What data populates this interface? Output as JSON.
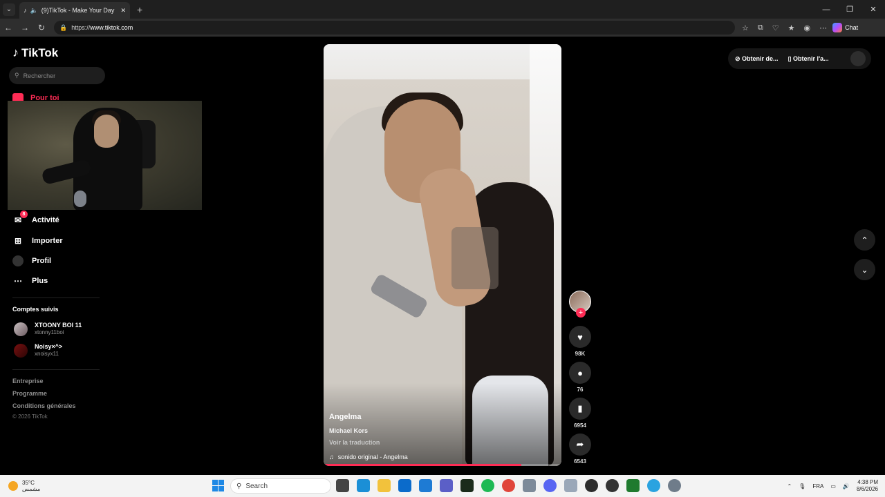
{
  "browser": {
    "tab_title": "(9)TikTok - Make Your Day",
    "url_scheme": "https://",
    "url_host": "www.tiktok.com",
    "chat_label": "Chat"
  },
  "sidebar": {
    "brand": "TikTok",
    "search_placeholder": "Rechercher",
    "for_you": "Pour toi",
    "activity": "Activité",
    "activity_badge": "8",
    "upload": "Importer",
    "profile": "Profil",
    "more": "Plus",
    "following_title": "Comptes suivis",
    "following": [
      {
        "name": "XTOONY BOI 11",
        "handle": "xtonny11boi"
      },
      {
        "name": "Noisy×^>",
        "handle": "xnoisyx11"
      }
    ],
    "footer": [
      "Entreprise",
      "Programme",
      "Conditions générales"
    ],
    "copyright": "© 2026 TikTok"
  },
  "header": {
    "get_coins": "Obtenir de...",
    "get_app": "Obtenir l'a..."
  },
  "video": {
    "author": "Angelma",
    "description": "Michael Kors",
    "translate": "Voir la traduction",
    "music": "sonido original - Angelma",
    "progress": 0.83
  },
  "actions": {
    "likes": "98K",
    "comments": "76",
    "saves": "6954",
    "shares": "6543"
  },
  "taskbar": {
    "temp": "35°C",
    "weather_desc": "مشمس",
    "search": "Search",
    "lang": "FRA",
    "time": "4:38 PM",
    "date": "8/6/2026"
  },
  "colors": {
    "accent": "#fe2c55",
    "background": "#000000"
  }
}
